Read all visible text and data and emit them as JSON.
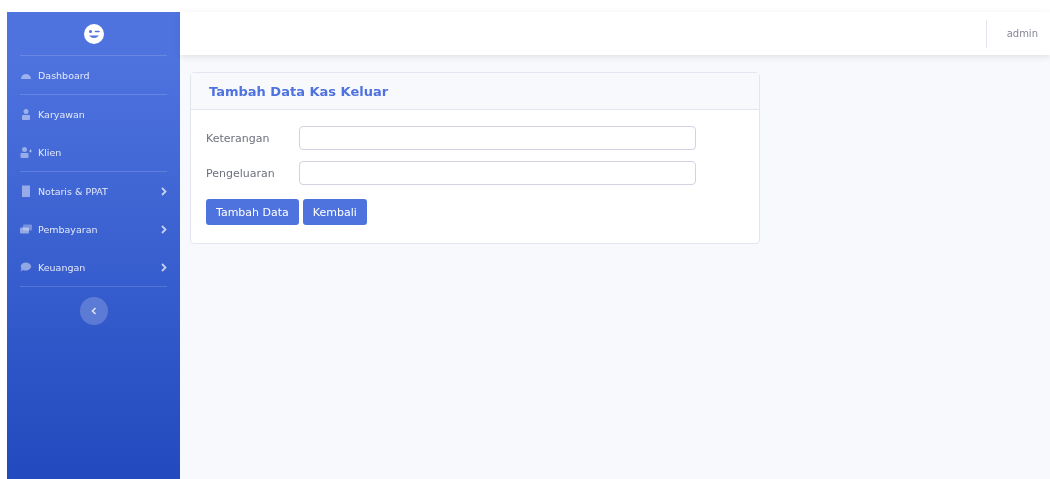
{
  "sidebar": {
    "sections": [
      {
        "items": [
          {
            "label": "Dashboard",
            "has_submenu": false
          }
        ]
      },
      {
        "items": [
          {
            "label": "Karyawan",
            "has_submenu": false
          },
          {
            "label": "Klien",
            "has_submenu": false
          }
        ]
      },
      {
        "items": [
          {
            "label": "Notaris & PPAT",
            "has_submenu": true
          },
          {
            "label": "Pembayaran",
            "has_submenu": true
          },
          {
            "label": "Keuangan",
            "has_submenu": true
          }
        ]
      }
    ]
  },
  "topbar": {
    "user": "admin"
  },
  "card": {
    "title": "Tambah Data Kas Keluar",
    "fields": [
      {
        "label": "Keterangan"
      },
      {
        "label": "Pengeluaran"
      }
    ],
    "buttons": [
      "Tambah Data",
      "Kembali"
    ]
  }
}
